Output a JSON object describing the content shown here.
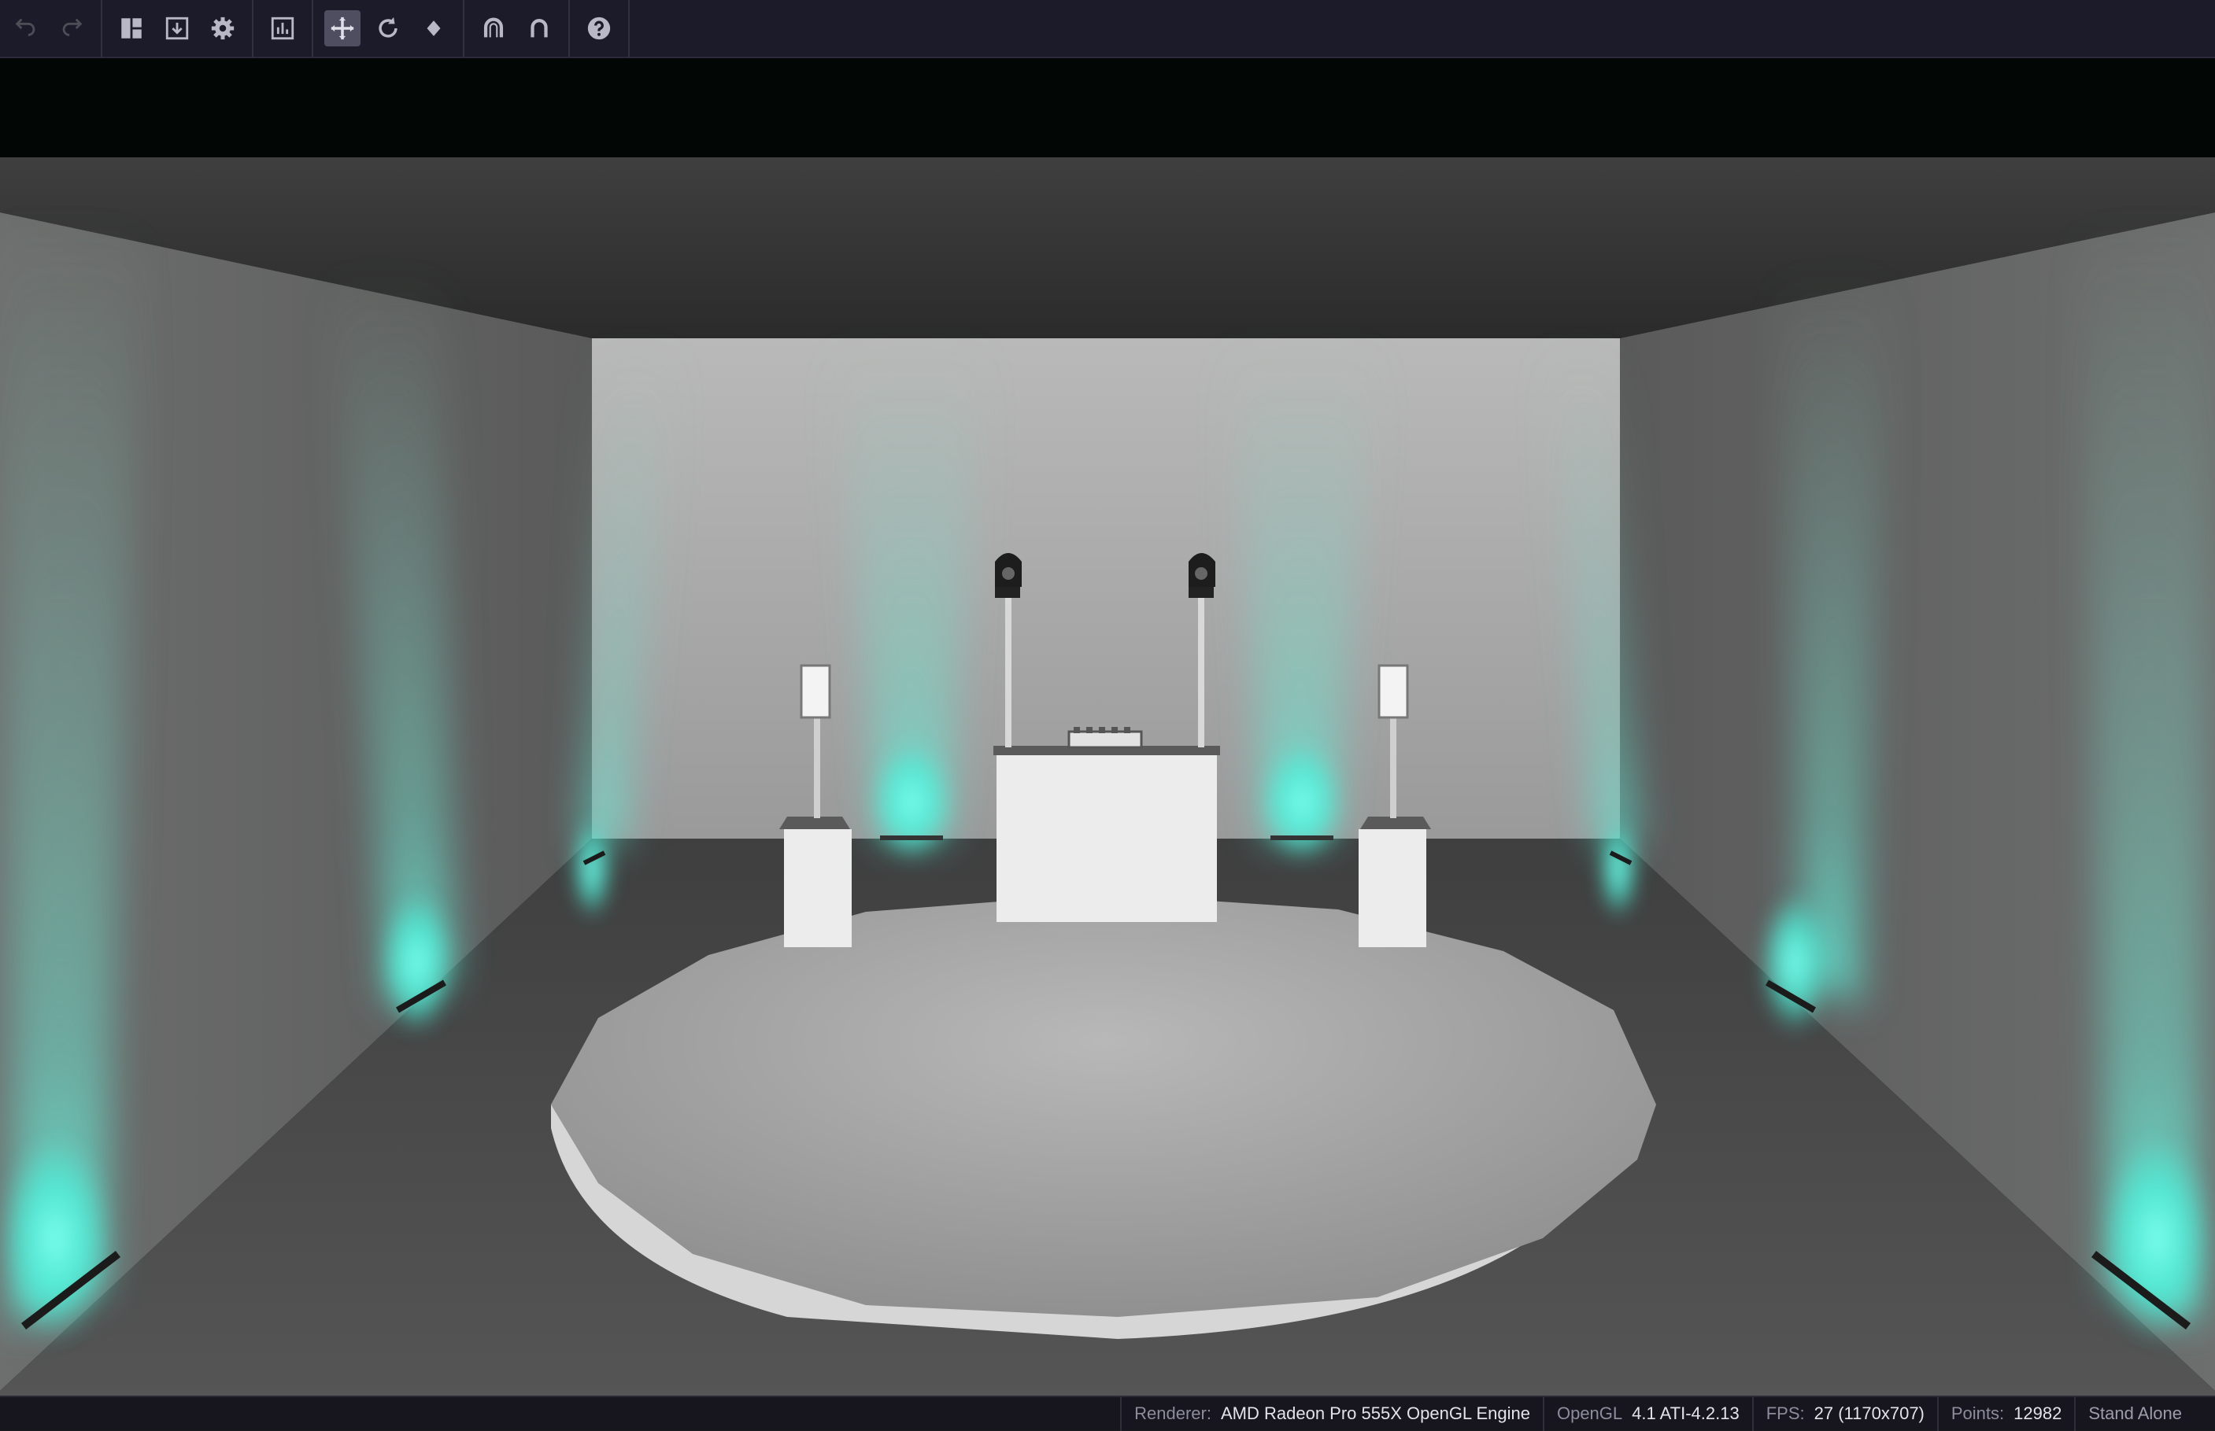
{
  "toolbar": {
    "groups": [
      {
        "name": "history",
        "buttons": [
          {
            "icon": "undo-icon",
            "enabled": false
          },
          {
            "icon": "redo-icon",
            "enabled": false
          }
        ]
      },
      {
        "name": "panels",
        "buttons": [
          {
            "icon": "layout-icon"
          },
          {
            "icon": "export-icon"
          },
          {
            "icon": "gear-icon"
          }
        ]
      },
      {
        "name": "info",
        "buttons": [
          {
            "icon": "chart-icon"
          }
        ]
      },
      {
        "name": "transform",
        "buttons": [
          {
            "icon": "move-icon",
            "active": true
          },
          {
            "icon": "rotate-icon"
          },
          {
            "icon": "diamond-icon"
          }
        ]
      },
      {
        "name": "snap",
        "buttons": [
          {
            "icon": "magnet-grid-icon"
          },
          {
            "icon": "magnet-icon"
          }
        ]
      },
      {
        "name": "help",
        "buttons": [
          {
            "icon": "help-icon"
          }
        ]
      }
    ]
  },
  "viewport": {
    "scene": "3D stage visualization",
    "light_color": "#5ff5e0"
  },
  "status": {
    "renderer_label": "Renderer:",
    "renderer_value": "AMD Radeon Pro 555X OpenGL Engine",
    "opengl_label": "OpenGL",
    "opengl_value": "4.1 ATI-4.2.13",
    "fps_label": "FPS:",
    "fps_value": "27 (1170x707)",
    "points_label": "Points:",
    "points_value": "12982",
    "mode": "Stand Alone"
  }
}
